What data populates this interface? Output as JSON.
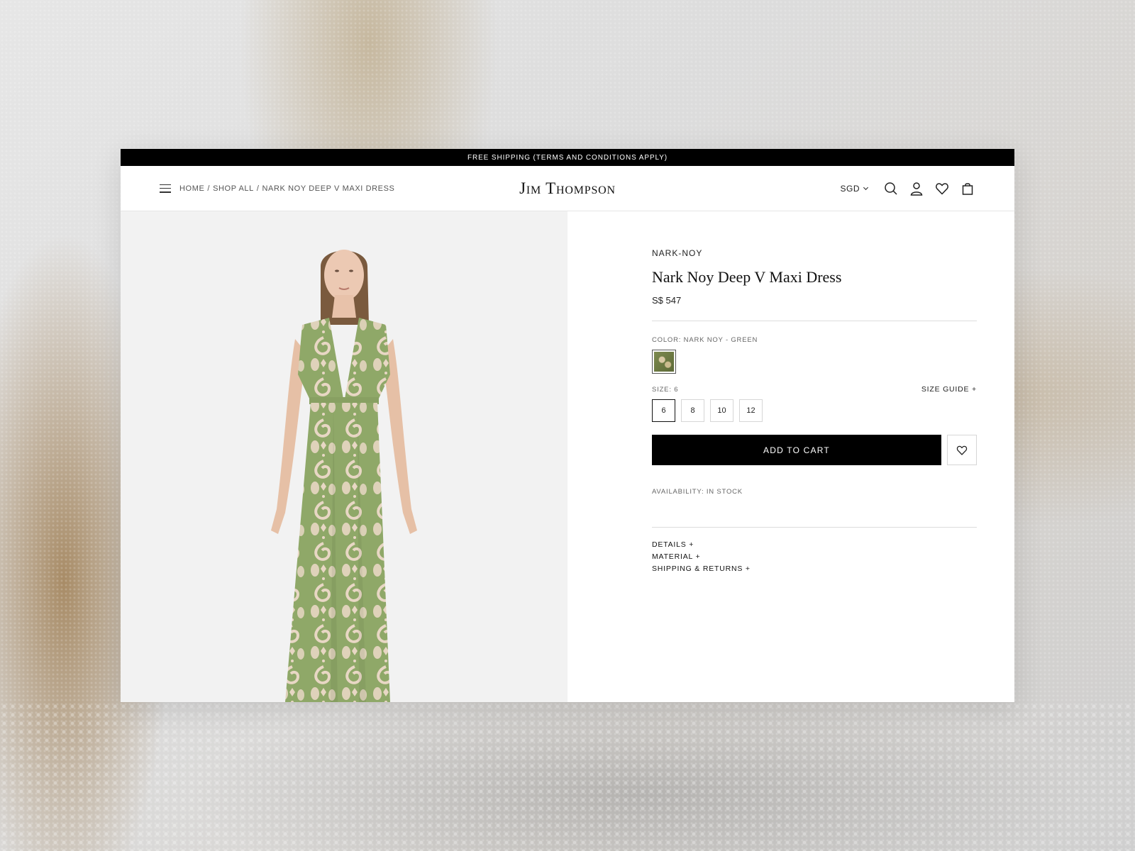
{
  "announcement": "FREE SHIPPING (TERMS AND CONDITIONS APPLY)",
  "header": {
    "breadcrumb": [
      "HOME",
      "SHOP ALL",
      "NARK NOY DEEP V MAXI DRESS"
    ],
    "breadcrumb_sep": "/",
    "logo": "Jim Thompson",
    "currency": "SGD",
    "icons": [
      "menu-icon",
      "search-icon",
      "account-icon",
      "heart-icon",
      "bag-icon"
    ]
  },
  "product": {
    "collection": "NARK-NOY",
    "title": "Nark Noy Deep V Maxi Dress",
    "price": "S$ 547",
    "color_label": "COLOR: NARK NOY - GREEN",
    "size_label": "SIZE: 6",
    "size_guide": "SIZE GUIDE  +",
    "sizes": [
      "6",
      "8",
      "10",
      "12"
    ],
    "selected_size": "6",
    "add_to_cart": "ADD TO CART",
    "availability": "AVAILABILITY: IN STOCK",
    "accordions": [
      "DETAILS  +",
      "MATERIAL  +",
      "SHIPPING & RETURNS  +"
    ]
  },
  "colors": {
    "dress_green": "#8fa868",
    "dress_pattern": "#e8d7c4",
    "gallery_bg": "#f2f2f2",
    "announce_bg": "#000000"
  }
}
